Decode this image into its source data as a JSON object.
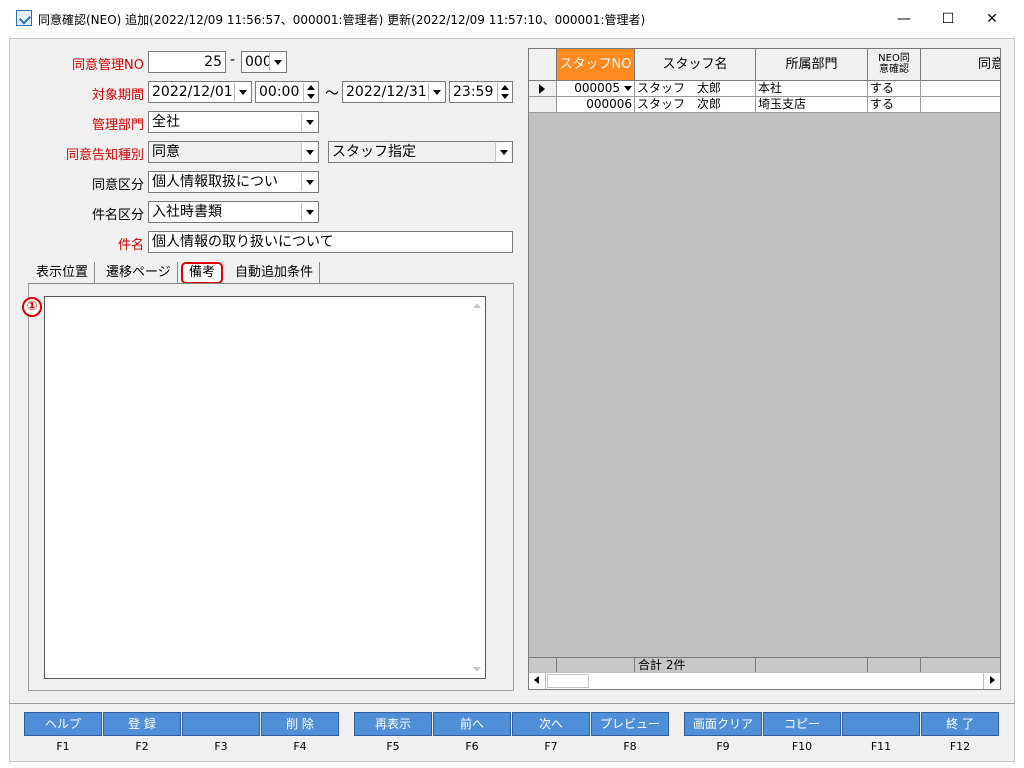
{
  "window": {
    "title": "同意確認(NEO) 追加(2022/12/09 11:56:57、000001:管理者) 更新(2022/12/09 11:57:10、000001:管理者)",
    "min_glyph": "—",
    "max_glyph": "☐",
    "close_glyph": "✕"
  },
  "form": {
    "consent_no": {
      "label": "同意管理NO",
      "value": "25",
      "sep": "-",
      "sub_value": "000"
    },
    "period": {
      "label": "対象期間",
      "start_date": "2022/12/01",
      "start_time": "00:00",
      "tilde": "～",
      "end_date": "2022/12/31",
      "end_time": "23:59"
    },
    "department": {
      "label": "管理部門",
      "value": "全社"
    },
    "notice_type": {
      "label": "同意告知種別",
      "value": "同意",
      "target_value": "スタッフ指定"
    },
    "consent_category": {
      "label": "同意区分",
      "value": "個人情報取扱につい"
    },
    "subject_category": {
      "label": "件名区分",
      "value": "入社時書類"
    },
    "subject": {
      "label": "件名",
      "value": "個人情報の取り扱いについて"
    }
  },
  "tabs": [
    {
      "label": "表示位置"
    },
    {
      "label": "遷移ページ"
    },
    {
      "label": "備考"
    },
    {
      "label": "自動追加条件"
    }
  ],
  "annotation": {
    "marker": "①"
  },
  "grid": {
    "headers": [
      "スタッフNO",
      "スタッフ名",
      "所属部門",
      "NEO同意確認",
      "同意"
    ],
    "header_neo_line1": "NEO同",
    "header_neo_line2": "意確認",
    "rows": [
      {
        "staff_no": "000005",
        "name": "スタッフ　太郎",
        "department": "本社",
        "neo_confirm": "する",
        "consent": ""
      },
      {
        "staff_no": "000006",
        "name": "スタッフ　次郎",
        "department": "埼玉支店",
        "neo_confirm": "する",
        "consent": ""
      }
    ],
    "footer_total": "合計 2件"
  },
  "function_keys": [
    {
      "label": "ヘルプ",
      "key": "F1"
    },
    {
      "label": "登 録",
      "key": "F2"
    },
    {
      "label": "",
      "key": "F3"
    },
    {
      "label": "削 除",
      "key": "F4"
    },
    {
      "label": "再表示",
      "key": "F5"
    },
    {
      "label": "前へ",
      "key": "F6"
    },
    {
      "label": "次へ",
      "key": "F7"
    },
    {
      "label": "プレビュー",
      "key": "F8"
    },
    {
      "label": "画面クリア",
      "key": "F9"
    },
    {
      "label": "コピー",
      "key": "F10"
    },
    {
      "label": "",
      "key": "F11"
    },
    {
      "label": "終 了",
      "key": "F12"
    }
  ],
  "colors": {
    "label_red": "#d40000",
    "active_header": "#ff8a1f",
    "fkey_blue": "#4f8fd8",
    "highlight": "#e00000"
  }
}
